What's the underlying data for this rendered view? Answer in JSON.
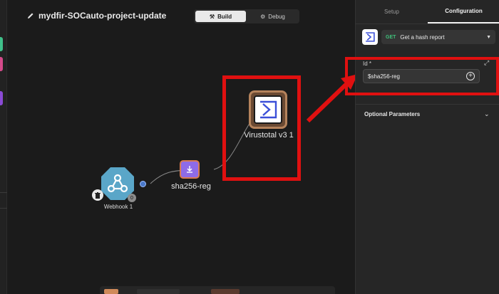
{
  "workflow": {
    "title": "mydfir-SOCauto-project-update"
  },
  "modes": [
    {
      "label": "Build",
      "icon": "wrench-icon",
      "active": true
    },
    {
      "label": "Debug",
      "icon": "bug-icon",
      "active": false
    }
  ],
  "nodes": {
    "webhook": {
      "label": "Webhook 1",
      "badge": "0"
    },
    "sha": {
      "label": "sha256-reg"
    },
    "virustotal": {
      "label": "Virustotal v3 1"
    }
  },
  "panel": {
    "tabs": [
      {
        "label": "Setup",
        "active": false
      },
      {
        "label": "Configuration",
        "active": true
      }
    ],
    "action": {
      "method": "GET",
      "name": "Get a hash report"
    },
    "id_field": {
      "label": "Id *",
      "value": "$sha256-reg"
    },
    "optional_label": "Optional Parameters"
  },
  "colors": {
    "highlight": "#e01010",
    "webhook": "#5aa6c8",
    "sha": "#8e6be8",
    "get": "#3fc07a",
    "virustotal_blue": "#3b4fd8"
  }
}
